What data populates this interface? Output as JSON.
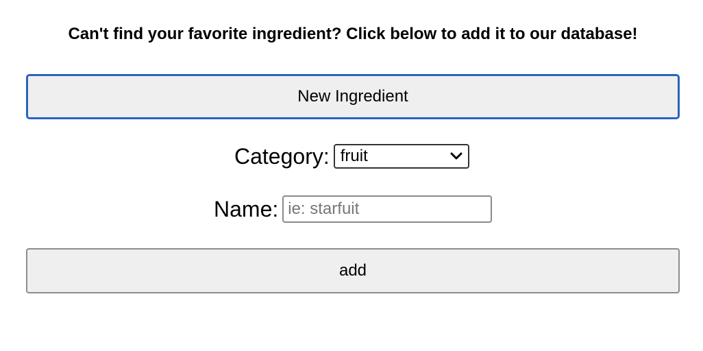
{
  "heading": "Can't find your favorite ingredient? Click below to add it to our database!",
  "new_ingredient_button": "New Ingredient",
  "category": {
    "label": "Category:",
    "selected": "fruit"
  },
  "name": {
    "label": "Name:",
    "placeholder": "ie: starfuit",
    "value": ""
  },
  "add_button": "add",
  "colors": {
    "focus_border": "#2a63c0",
    "button_bg": "#efefef"
  },
  "icons": {
    "select_arrow": "chevron-down-icon"
  }
}
